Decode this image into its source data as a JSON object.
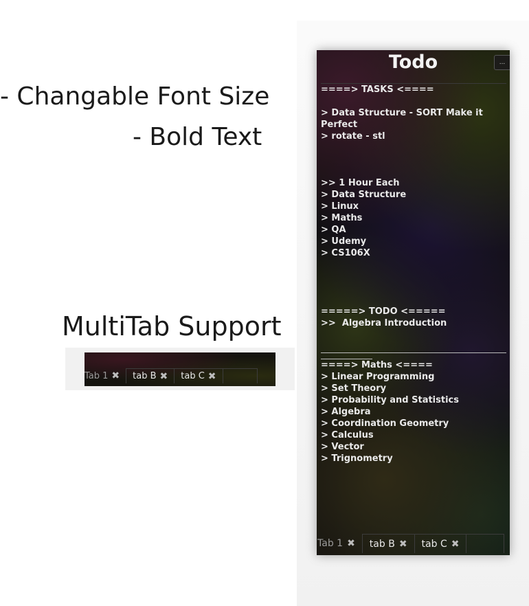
{
  "annotations": {
    "feature_1": "- Changable Font Size",
    "feature_2": "- Bold Text",
    "feature_3": "MultiTab Support"
  },
  "app": {
    "title": "Todo",
    "menu_button": "...",
    "lines": [
      "====> TASKS <====",
      "",
      "> Data Structure - SORT Make it Perfect",
      "> rotate - stl",
      "",
      "",
      "",
      ">> 1 Hour Each",
      "> Data Structure",
      "> Linux",
      "> Maths",
      "> QA",
      "> Udemy",
      "> CS106X",
      "",
      "",
      "",
      "",
      "=====> TODO <=====",
      ">>  Algebra Introduction",
      "",
      "",
      "",
      "====> Maths <====",
      "> Linear Programming",
      "> Set Theory",
      "> Probability and Statistics",
      "> Algebra",
      "> Coordination Geometry",
      "> Calculus",
      "> Vector",
      "> Trignometry"
    ],
    "tabs": [
      {
        "label": "Tab 1",
        "close": "✖"
      },
      {
        "label": "tab B",
        "close": "✖"
      },
      {
        "label": "tab C",
        "close": "✖"
      }
    ]
  },
  "demo_tabs": [
    {
      "label": "Tab 1",
      "close": "✖"
    },
    {
      "label": "tab B",
      "close": "✖"
    },
    {
      "label": "tab C",
      "close": "✖"
    }
  ]
}
